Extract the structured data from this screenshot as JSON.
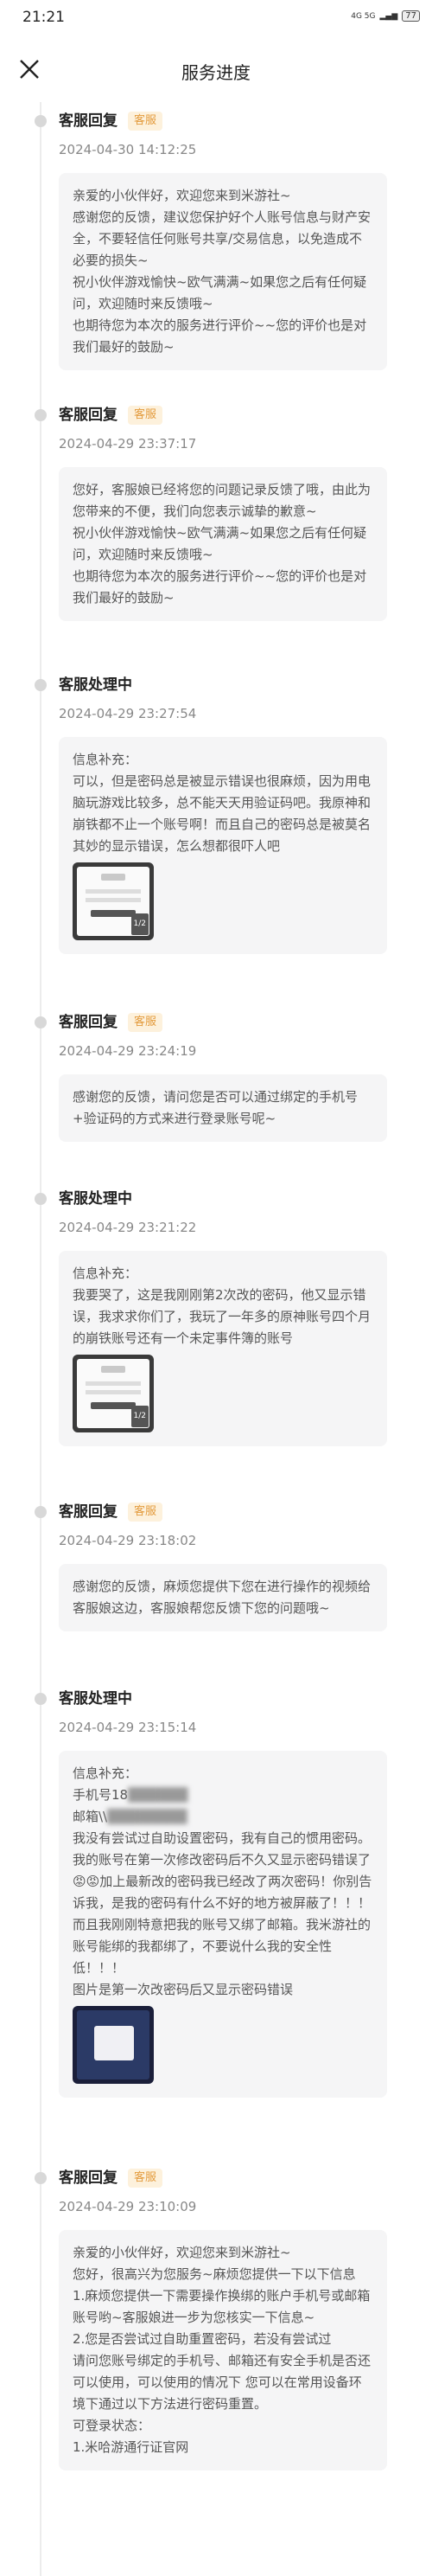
{
  "status_bar": {
    "time": "21:21",
    "icons_text": "4G 5G",
    "battery": "77"
  },
  "nav": {
    "title": "服务进度"
  },
  "entries": [
    {
      "title": "客服回复",
      "badge": "客服",
      "date": "2024-04-30 14:12:25",
      "lines": [
        "亲爱的小伙伴好，欢迎您来到米游社~",
        "感谢您的反馈，建议您保护好个人账号信息与财产安全，不要轻信任何账号共享/交易信息，以免造成不必要的损失~",
        "祝小伙伴游戏愉快~欧气满满~如果您之后有任何疑问，欢迎随时来反馈哦~",
        "也期待您为本次的服务进行评价~~您的评价也是对我们最好的鼓励~"
      ]
    },
    {
      "title": "客服回复",
      "badge": "客服",
      "date": "2024-04-29 23:37:17",
      "lines": [
        "您好，客服娘已经将您的问题记录反馈了哦，由此为您带来的不便，我们向您表示诚挚的歉意~",
        "祝小伙伴游戏愉快~欧气满满~如果您之后有任何疑问，欢迎随时来反馈哦~",
        "也期待您为本次的服务进行评价~~您的评价也是对我们最好的鼓励~"
      ]
    },
    {
      "title": "客服处理中",
      "date": "2024-04-29 23:27:54",
      "label": "信息补充：",
      "text": "可以，但是密码总是被显示错误也很麻烦，因为用电脑玩游戏比较多，总不能天天用验证码吧。我原神和崩铁都不止一个账号啊！而且自己的密码总是被莫名其妙的显示错误，怎么想都很吓人吧",
      "thumb_number": "1/2"
    },
    {
      "title": "客服回复",
      "badge": "客服",
      "date": "2024-04-29 23:24:19",
      "lines": [
        "感谢您的反馈，请问您是否可以通过绑定的手机号+验证码的方式来进行登录账号呢~"
      ]
    },
    {
      "title": "客服处理中",
      "date": "2024-04-29 23:21:22",
      "label": "信息补充：",
      "text": "我要哭了，这是我刚刚第2次改的密码，他又显示错误，我求求你们了，我玩了一年多的原神账号四个月的崩铁账号还有一个未定事件簿的账号",
      "thumb_number": "1/2"
    },
    {
      "title": "客服回复",
      "badge": "客服",
      "date": "2024-04-29 23:18:02",
      "lines": [
        "感谢您的反馈，麻烦您提供下您在进行操作的视频给客服娘这边，客服娘帮您反馈下您的问题哦~"
      ]
    },
    {
      "title": "客服处理中",
      "date": "2024-04-29 23:15:14",
      "label": "信息补充：",
      "phone": "手机号18",
      "email": "邮箱\\\\",
      "lines": [
        "我没有尝试过自助设置密码，我有自己的惯用密码。",
        "我的账号在第一次修改密码后不久又显示密码错误了😡😡加上最新改的密码我已经改了两次密码！你别告诉我，是我的密码有什么不好的地方被屏蔽了！！！而且我刚刚特意把我的账号又绑了邮箱。我米游社的账号能绑的我都绑了，不要说什么我的安全性低！！！",
        "图片是第一次改密码后又显示密码错误"
      ]
    },
    {
      "title": "客服回复",
      "badge": "客服",
      "date": "2024-04-29 23:10:09",
      "lines": [
        "亲爱的小伙伴好，欢迎您来到米游社~",
        "您好，很高兴为您服务~麻烦您提供一下以下信息",
        "1.麻烦您提供一下需要操作换绑的账户手机号或邮箱账号哟~客服娘进一步为您核实一下信息~",
        "2.您是否尝试过自助重置密码，若没有尝试过",
        "请问您账号绑定的手机号、邮箱还有安全手机是否还可以使用，可以使用的情况下 您可以在常用设备环境下通过以下方法进行密码重置。",
        "可登录状态：",
        "1.米哈游通行证官网"
      ]
    }
  ]
}
